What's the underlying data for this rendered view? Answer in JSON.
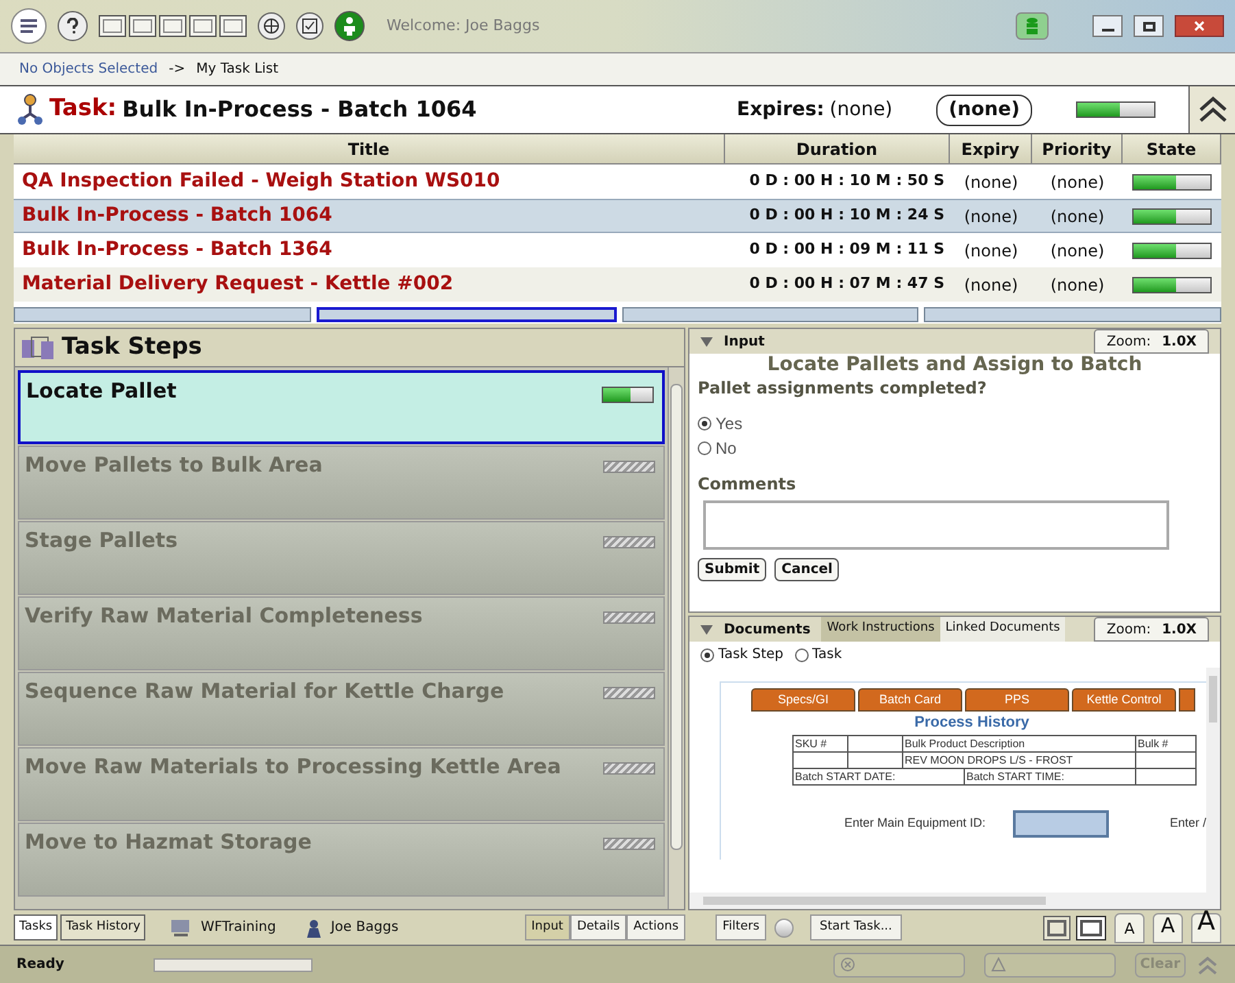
{
  "toolbar": {
    "welcome": "Welcome: Joe Baggs"
  },
  "breadcrumb": {
    "selection": "No Objects Selected",
    "separator": "->",
    "current": "My Task List"
  },
  "task_header": {
    "label": "Task:",
    "name": "Bulk In-Process - Batch 1064",
    "expires_label": "Expires:",
    "expires_value": "(none)",
    "badge": "(none)",
    "level": 0.55
  },
  "table": {
    "columns": [
      "Title",
      "Duration",
      "Expiry",
      "Priority",
      "State"
    ],
    "rows": [
      {
        "title": "QA Inspection Failed - Weigh Station WS010",
        "duration": "0 D : 00 H : 10 M : 50 S",
        "expiry": "(none)",
        "priority": "(none)",
        "level": 0.55,
        "selected": false
      },
      {
        "title": "Bulk In-Process - Batch 1064",
        "duration": "0 D : 00 H : 10 M : 24 S",
        "expiry": "(none)",
        "priority": "(none)",
        "level": 0.55,
        "selected": true
      },
      {
        "title": "Bulk In-Process - Batch 1364",
        "duration": "0 D : 00 H : 09 M : 11 S",
        "expiry": "(none)",
        "priority": "(none)",
        "level": 0.55,
        "selected": false
      },
      {
        "title": "Material Delivery Request - Kettle #002",
        "duration": "0 D : 00 H : 07 M : 47 S",
        "expiry": "(none)",
        "priority": "(none)",
        "level": 0.55,
        "selected": false
      }
    ],
    "pages": [
      {
        "selected": false
      },
      {
        "selected": true
      },
      {
        "selected": false
      },
      {
        "selected": false
      }
    ]
  },
  "task_steps": {
    "title": "Task Steps",
    "steps": [
      {
        "label": "Locate Pallet",
        "selected": true,
        "kind": "active",
        "level": 0.55
      },
      {
        "label": "Move Pallets to Bulk Area",
        "selected": false,
        "kind": "pending"
      },
      {
        "label": "Stage Pallets",
        "selected": false,
        "kind": "pending"
      },
      {
        "label": "Verify Raw Material Completeness",
        "selected": false,
        "kind": "pending"
      },
      {
        "label": "Sequence Raw Material for Kettle Charge",
        "selected": false,
        "kind": "pending"
      },
      {
        "label": "Move Raw Materials to Processing Kettle Area",
        "selected": false,
        "kind": "pending"
      },
      {
        "label": "Move to Hazmat Storage",
        "selected": false,
        "kind": "pending"
      }
    ]
  },
  "input_panel": {
    "title": "Input",
    "zoom_label": "Zoom:",
    "zoom_value": "1.0X",
    "form_title": "Locate Pallets and Assign to Batch",
    "question": "Pallet assignments completed?",
    "options": [
      {
        "label": "Yes",
        "selected": true
      },
      {
        "label": "No",
        "selected": false
      }
    ],
    "comments_label": "Comments",
    "buttons": [
      "Submit",
      "Cancel"
    ]
  },
  "documents_panel": {
    "title": "Documents",
    "tabs": [
      {
        "label": "Work Instructions",
        "selected": true
      },
      {
        "label": "Linked Documents",
        "selected": false
      }
    ],
    "zoom_label": "Zoom:",
    "zoom_value": "1.0X",
    "scope": [
      {
        "label": "Task Step",
        "selected": true
      },
      {
        "label": "Task",
        "selected": false
      }
    ],
    "document": {
      "tabs": [
        "Specs/GI",
        "Batch Card",
        "PPS",
        "Kettle Control"
      ],
      "heading": "Process History",
      "table": [
        {
          "sku": "SKU #",
          "description": "Bulk Product Description",
          "bulk": "Bulk #"
        },
        {
          "description": "REV MOON DROPS L/S - FROST"
        }
      ],
      "start_date": "Batch START DATE:",
      "start_time": "Batch START TIME:",
      "equipment_label": "Enter Main Equipment ID:",
      "cut_label": "Enter /"
    }
  },
  "bottom_bar": {
    "tabs": [
      {
        "label": "Tasks",
        "selected": true
      },
      {
        "label": "Task History",
        "selected": false
      }
    ],
    "station": "WFTraining",
    "user": "Joe Baggs",
    "views": [
      {
        "label": "Input",
        "selected": true
      },
      {
        "label": "Details",
        "selected": false
      },
      {
        "label": "Actions",
        "selected": false
      }
    ],
    "filters": "Filters",
    "start": "Start Task...",
    "font_sizes": [
      "A",
      "A",
      "A"
    ]
  },
  "status_bar": {
    "status": "Ready",
    "level": 0,
    "clear": "Clear"
  }
}
